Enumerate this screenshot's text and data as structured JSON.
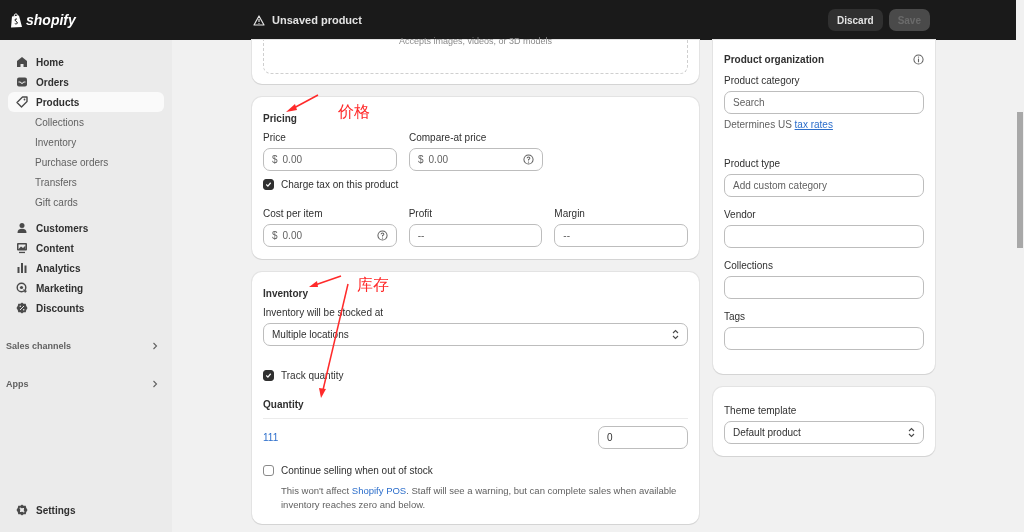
{
  "brand": "shopify",
  "top_bar": {
    "title": "Unsaved product",
    "buttons": [
      {
        "label": "Discard",
        "disabled": false
      },
      {
        "label": "Save",
        "disabled": true
      }
    ]
  },
  "sidebar": {
    "items": [
      {
        "label": "Home",
        "selected": false
      },
      {
        "label": "Orders",
        "selected": false
      },
      {
        "label": "Products",
        "selected": true,
        "children": [
          {
            "label": "Collections",
            "selected": false
          },
          {
            "label": "Inventory",
            "selected": false
          },
          {
            "label": "Purchase orders",
            "selected": false
          },
          {
            "label": "Transfers",
            "selected": false
          },
          {
            "label": "Gift cards",
            "selected": false
          }
        ]
      },
      {
        "label": "Customers",
        "selected": false
      },
      {
        "label": "Content",
        "selected": false
      },
      {
        "label": "Analytics",
        "selected": false
      },
      {
        "label": "Marketing",
        "selected": false
      },
      {
        "label": "Discounts",
        "selected": false
      }
    ],
    "sections": [
      {
        "label": "Sales channels"
      },
      {
        "label": "Apps"
      }
    ],
    "footer": {
      "label": "Settings"
    }
  },
  "media": {
    "hint": "Accepts images, videos, or 3D models"
  },
  "pricing": {
    "title": "Pricing",
    "fields": [
      {
        "label": "Price",
        "prefix": "$",
        "placeholder": "0.00",
        "help": false
      },
      {
        "label": "Compare-at price",
        "prefix": "$",
        "placeholder": "0.00",
        "help": true
      }
    ],
    "charge_tax": {
      "label": "Charge tax on this product",
      "checked": true
    },
    "cost_fields": [
      {
        "label": "Cost per item",
        "prefix": "$",
        "placeholder": "0.00",
        "help": true
      },
      {
        "label": "Profit",
        "placeholder": "--",
        "help": false
      },
      {
        "label": "Margin",
        "placeholder": "--",
        "help": false
      }
    ]
  },
  "inventory": {
    "title": "Inventory",
    "location_label": "Inventory will be stocked at",
    "location_value": "Multiple locations",
    "track": {
      "label": "Track quantity",
      "checked": true
    },
    "quantity_title": "Quantity",
    "locations": [
      {
        "name": "111",
        "value": "0"
      }
    ],
    "continue_selling": {
      "label": "Continue selling when out of stock",
      "checked": false,
      "note_before": "This won't affect ",
      "link": "Shopify POS",
      "note_after": ". Staff will see a warning, but can complete sales when available inventory reaches zero and below."
    }
  },
  "organization": {
    "title": "Product organization",
    "fields": [
      {
        "label": "Product category",
        "placeholder": "Search",
        "hint_before": "Determines US ",
        "hint_link": "tax rates"
      },
      {
        "label": "Product type",
        "placeholder": "Add custom category"
      },
      {
        "label": "Vendor"
      },
      {
        "label": "Collections"
      },
      {
        "label": "Tags"
      }
    ]
  },
  "theme": {
    "label": "Theme template",
    "value": "Default product"
  },
  "annotations": [
    {
      "text": "价格"
    },
    {
      "text": "库存"
    }
  ]
}
